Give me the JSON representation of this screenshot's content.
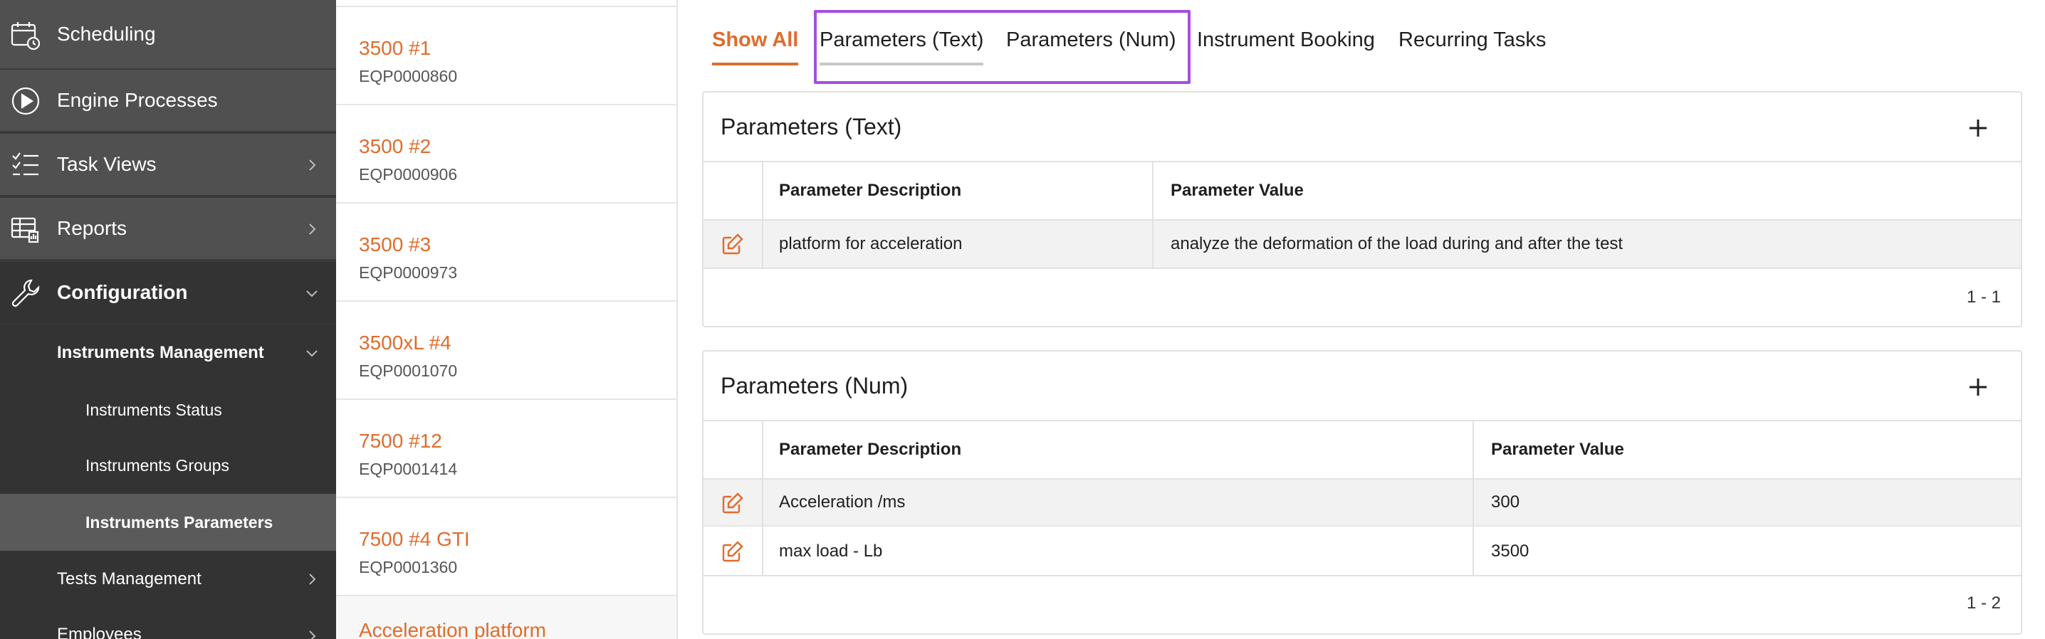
{
  "sidebar": {
    "items": [
      {
        "label": "Scheduling",
        "icon": "calendar-clock-icon"
      },
      {
        "label": "Engine Processes",
        "icon": "play-circle-icon"
      },
      {
        "label": "Task Views",
        "icon": "checklist-icon"
      },
      {
        "label": "Reports",
        "icon": "report-table-icon"
      },
      {
        "label": "Configuration",
        "icon": "wrench-icon"
      }
    ],
    "sub_items": [
      {
        "label": "Instruments Management"
      },
      {
        "label": "Instruments Status"
      },
      {
        "label": "Instruments Groups"
      },
      {
        "label": "Instruments Parameters"
      },
      {
        "label": "Tests Management"
      },
      {
        "label": "Employees"
      }
    ]
  },
  "instrument_list": [
    {
      "name": "3500 #1",
      "code": "EQP0000860"
    },
    {
      "name": "3500 #2",
      "code": "EQP0000906"
    },
    {
      "name": "3500 #3",
      "code": "EQP0000973"
    },
    {
      "name": "3500xL #4",
      "code": "EQP0001070"
    },
    {
      "name": "7500 #12",
      "code": "EQP0001414"
    },
    {
      "name": "7500 #4 GTI",
      "code": "EQP0001360"
    },
    {
      "name": "Acceleration platform",
      "code": ""
    }
  ],
  "tabs": [
    {
      "label": "Show All"
    },
    {
      "label": "Parameters (Text)"
    },
    {
      "label": "Parameters (Num)"
    },
    {
      "label": "Instrument Booking"
    },
    {
      "label": "Recurring Tasks"
    }
  ],
  "param_text": {
    "title": "Parameters (Text)",
    "col_desc": "Parameter Description",
    "col_value": "Parameter Value",
    "rows": [
      {
        "desc": "platform for acceleration",
        "value": "analyze the deformation of the load during and after the test"
      }
    ],
    "pagination": "1 - 1"
  },
  "param_num": {
    "title": "Parameters (Num)",
    "col_desc": "Parameter Description",
    "col_value": "Parameter Value",
    "rows": [
      {
        "desc": "Acceleration /ms",
        "value": "300"
      },
      {
        "desc": "max load - Lb",
        "value": "3500"
      }
    ],
    "pagination": "1 - 2"
  },
  "colors": {
    "accent": "#e06c2c",
    "highlight": "#a64ee0",
    "sidebar_bg": "#3a3a3a"
  }
}
